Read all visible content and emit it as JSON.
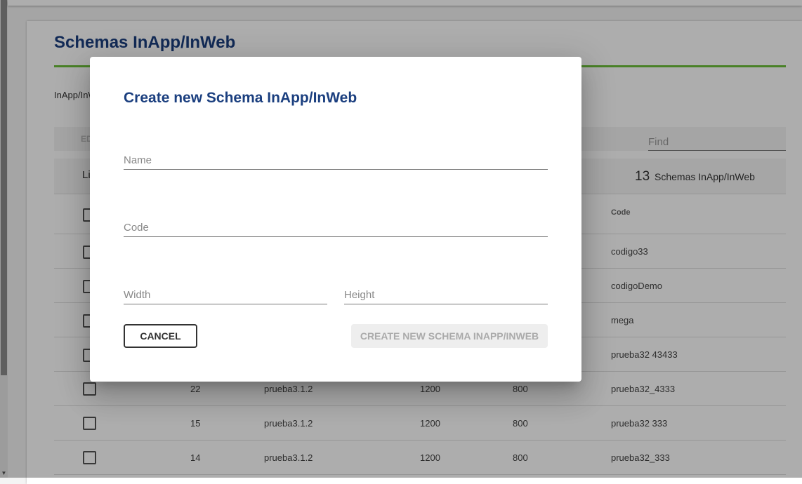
{
  "page": {
    "title": "Schemas InApp/InWeb",
    "breadcrumb": "InApp/InWeb",
    "toolbar_edit": "EDIT",
    "find_placeholder": "Find",
    "list_label": "List",
    "count": "13",
    "count_label": "Schemas InApp/InWeb"
  },
  "table": {
    "code_header": "Code",
    "rows": [
      {
        "code": "codigo33"
      },
      {
        "code": "codigoDemo"
      },
      {
        "code": "mega"
      },
      {
        "code": "prueba32 43433"
      },
      {
        "id": "22",
        "name": "prueba3.1.2",
        "width": "1200",
        "height": "800",
        "code": "prueba32_4333"
      },
      {
        "id": "15",
        "name": "prueba3.1.2",
        "width": "1200",
        "height": "800",
        "code": "prueba32 333"
      },
      {
        "id": "14",
        "name": "prueba3.1.2",
        "width": "1200",
        "height": "800",
        "code": "prueba32_333"
      }
    ]
  },
  "modal": {
    "title": "Create new Schema InApp/InWeb",
    "name_placeholder": "Name",
    "code_placeholder": "Code",
    "width_placeholder": "Width",
    "height_placeholder": "Height",
    "name_value": "",
    "code_value": "",
    "width_value": "",
    "height_value": "",
    "cancel_label": "Cancel",
    "create_label": "Create new Schema InApp/InWeb"
  },
  "colors": {
    "title": "#1b3f7f",
    "accent_rule": "#6cbf3a",
    "overlay": "rgba(0,0,0,0.32)",
    "disabled_button": "#eeeeee"
  }
}
